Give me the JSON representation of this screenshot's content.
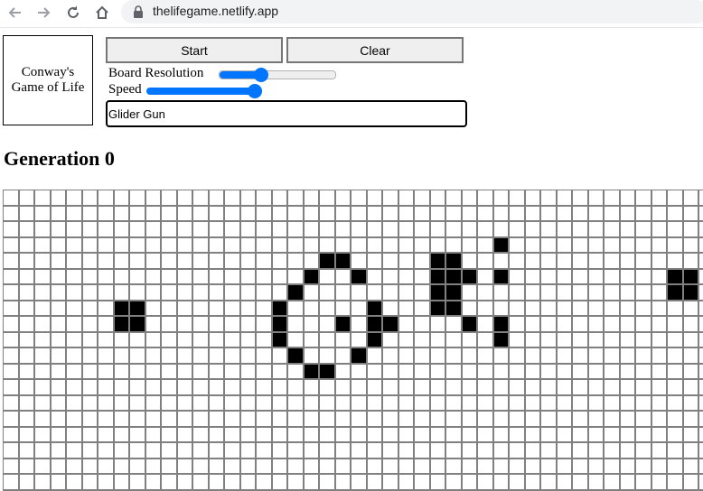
{
  "browser": {
    "url": "thelifegame.netlify.app"
  },
  "app": {
    "title": "Conway's Game of Life",
    "start_label": "Start",
    "clear_label": "Clear",
    "board_resolution_label": "Board Resolution",
    "speed_label": "Speed",
    "board_resolution_level": 0.36,
    "speed_level": 1.0,
    "accent_color": "#0075ff",
    "pattern_selected": "Glider Gun",
    "generation_label": "Generation 0"
  },
  "board": {
    "columns": 45,
    "rows": 19,
    "alive_cells": [
      [
        20,
        4
      ],
      [
        21,
        4
      ],
      [
        27,
        4
      ],
      [
        28,
        4
      ],
      [
        31,
        3
      ],
      [
        29,
        5
      ],
      [
        31,
        5
      ],
      [
        19,
        5
      ],
      [
        22,
        5
      ],
      [
        27,
        5
      ],
      [
        28,
        5
      ],
      [
        42,
        5
      ],
      [
        43,
        5
      ],
      [
        7,
        7
      ],
      [
        8,
        7
      ],
      [
        17,
        7
      ],
      [
        23,
        7
      ],
      [
        27,
        7
      ],
      [
        28,
        7
      ],
      [
        42,
        6
      ],
      [
        43,
        6
      ],
      [
        18,
        6
      ],
      [
        27,
        6
      ],
      [
        28,
        6
      ],
      [
        7,
        8
      ],
      [
        8,
        8
      ],
      [
        17,
        8
      ],
      [
        21,
        8
      ],
      [
        23,
        8
      ],
      [
        24,
        8
      ],
      [
        29,
        8
      ],
      [
        31,
        8
      ],
      [
        17,
        9
      ],
      [
        23,
        9
      ],
      [
        31,
        9
      ],
      [
        18,
        10
      ],
      [
        22,
        10
      ],
      [
        19,
        11
      ],
      [
        20,
        11
      ]
    ]
  }
}
